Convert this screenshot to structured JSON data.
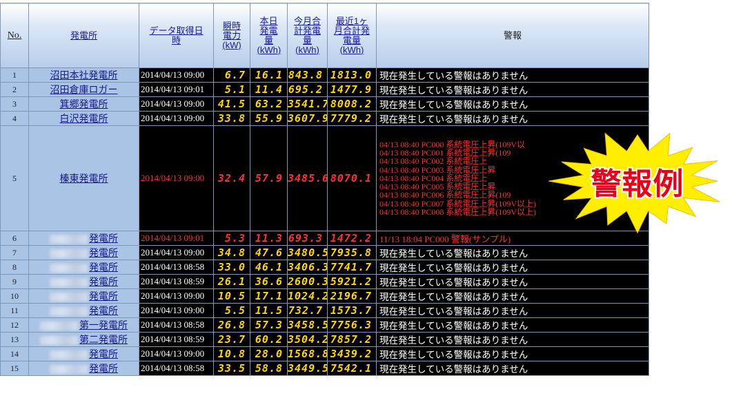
{
  "headers": {
    "no": "No.",
    "station": "発電所",
    "date": "データ取得日時",
    "instant": "瞬時電力",
    "instant_unit": "(kW)",
    "today": "本日発電量",
    "today_unit": "(kWh)",
    "month": "今月合計発電量",
    "month_unit": "(kWh)",
    "recent": "最近1ヶ月合計発電量",
    "recent_unit": "(kWh)",
    "alert": "警報"
  },
  "rows": [
    {
      "no": "1",
      "station": "沼田本社発電所",
      "date": "2014/04/13 09:00",
      "instant": "6.7",
      "today": "16.1",
      "month": "843.8",
      "recent": "1813.0",
      "alert": "現在発生している警報はありません"
    },
    {
      "no": "2",
      "station": "沼田倉庫ロガー",
      "date": "2014/04/13 09:01",
      "instant": "5.1",
      "today": "11.4",
      "month": "695.2",
      "recent": "1477.9",
      "alert": "現在発生している警報はありません"
    },
    {
      "no": "3",
      "station": "箕郷発電所",
      "date": "2014/04/13 09:00",
      "instant": "41.5",
      "today": "63.2",
      "month": "3541.7",
      "recent": "8008.2",
      "alert": "現在発生している警報はありません"
    },
    {
      "no": "4",
      "station": "白沢発電所",
      "date": "2014/04/13 09:00",
      "instant": "33.8",
      "today": "55.9",
      "month": "3607.9",
      "recent": "7779.2",
      "alert": "現在発生している警報はありません"
    },
    {
      "no": "5",
      "station": "榛東発電所",
      "date": "2014/04/13 09:00",
      "instant": "32.4",
      "today": "57.9",
      "month": "3485.6",
      "recent": "8070.1",
      "alerts": [
        "04/13 08:40 PC000 系統電圧上昇(109V以",
        "04/13 08:40 PC001 系統電圧上昇(109",
        "04/13 08:40 PC002 系統電圧上",
        "04/13 08:40 PC003 系統電圧上昇",
        "04/13 08:40 PC004 系統電圧上",
        "04/13 08:40 PC005 系統電圧上昇",
        "04/13 08:40 PC006 系統電圧上昇(109",
        "04/13 08:40 PC007 系統電圧上昇(109V以上)",
        "04/13 08:40 PC008 系統電圧上昇(109V以上)"
      ]
    },
    {
      "no": "6",
      "station": "発電所",
      "date": "2014/04/13 09:01",
      "instant": "5.3",
      "today": "11.3",
      "month": "693.3",
      "recent": "1472.2",
      "alert": "11/13 18:04 PC000 警報(サンプル)"
    },
    {
      "no": "7",
      "station": "発電所",
      "date": "2014/04/13 09:00",
      "instant": "34.8",
      "today": "47.6",
      "month": "3480.5",
      "recent": "7935.8",
      "alert": "現在発生している警報はありません"
    },
    {
      "no": "8",
      "station": "発電所",
      "date": "2014/04/13 08:58",
      "instant": "33.0",
      "today": "46.1",
      "month": "3406.3",
      "recent": "7741.7",
      "alert": "現在発生している警報はありません"
    },
    {
      "no": "9",
      "station": "発電所",
      "date": "2014/04/13 08:59",
      "instant": "26.1",
      "today": "36.6",
      "month": "2600.3",
      "recent": "5921.2",
      "alert": "現在発生している警報はありません"
    },
    {
      "no": "10",
      "station": "発電所",
      "date": "2014/04/13 09:00",
      "instant": "10.5",
      "today": "17.1",
      "month": "1024.2",
      "recent": "2196.7",
      "alert": "現在発生している警報はありません"
    },
    {
      "no": "11",
      "station": "発電所",
      "date": "2014/04/13 09:00",
      "instant": "5.5",
      "today": "11.5",
      "month": "732.7",
      "recent": "1573.7",
      "alert": "現在発生している警報はありません"
    },
    {
      "no": "12",
      "station": "第一発電所",
      "date": "2014/04/13 08:58",
      "instant": "26.8",
      "today": "57.3",
      "month": "3458.5",
      "recent": "7756.3",
      "alert": "現在発生している警報はありません"
    },
    {
      "no": "13",
      "station": "第二発電所",
      "date": "2014/04/13 08:59",
      "instant": "23.7",
      "today": "60.2",
      "month": "3504.2",
      "recent": "7857.2",
      "alert": "現在発生している警報はありません"
    },
    {
      "no": "14",
      "station": "発電所",
      "date": "2014/04/13 09:00",
      "instant": "10.8",
      "today": "28.0",
      "month": "1568.8",
      "recent": "3439.2",
      "alert": "現在発生している警報はありません"
    },
    {
      "no": "15",
      "station": "発電所",
      "date": "2014/04/13 08:58",
      "instant": "33.5",
      "today": "58.8",
      "month": "3449.5",
      "recent": "7542.1",
      "alert": "現在発生している警報はありません"
    }
  ],
  "burst": {
    "text": "警報例",
    "fill": "#ffee00",
    "text_color": "#e8001a"
  }
}
